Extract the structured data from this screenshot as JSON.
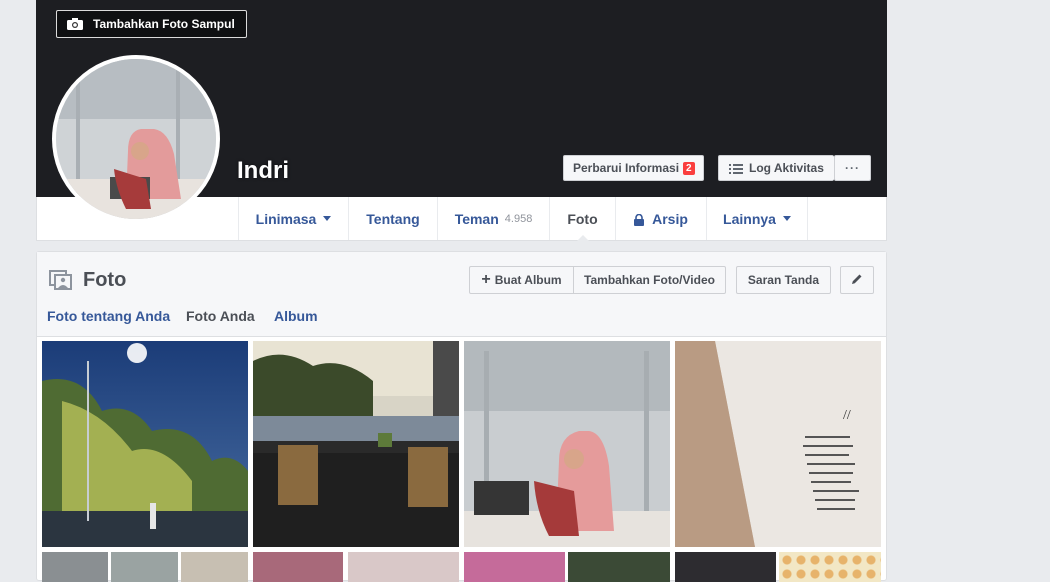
{
  "cover": {
    "add_cover_label": "Tambahkan Foto Sampul"
  },
  "profile": {
    "name": "Indri"
  },
  "actions": {
    "update_info": "Perbarui Informasi",
    "update_badge": "2",
    "activity_log": "Log Aktivitas",
    "more": "···"
  },
  "nav": {
    "items": [
      {
        "label": "Linimasa"
      },
      {
        "label": "Tentang"
      },
      {
        "label": "Teman",
        "count": "4.958"
      },
      {
        "label": "Foto"
      },
      {
        "label": "Arsip"
      },
      {
        "label": "Lainnya"
      }
    ]
  },
  "photos": {
    "title": "Foto",
    "create_album": "Buat Album",
    "add_photo_video": "Tambahkan Foto/Video",
    "tag_suggestions": "Saran Tanda",
    "tabs": [
      {
        "label": "Foto tentang Anda"
      },
      {
        "label": "Foto Anda"
      },
      {
        "label": "Album"
      }
    ]
  },
  "icons": {
    "camera": "camera-icon",
    "lock": "lock-icon",
    "list": "list-icon",
    "pencil": "pencil-icon",
    "photos": "photos-icon"
  },
  "colors": {
    "link": "#365899",
    "badge": "#fa3e3e",
    "cover": "#1d1e22"
  }
}
